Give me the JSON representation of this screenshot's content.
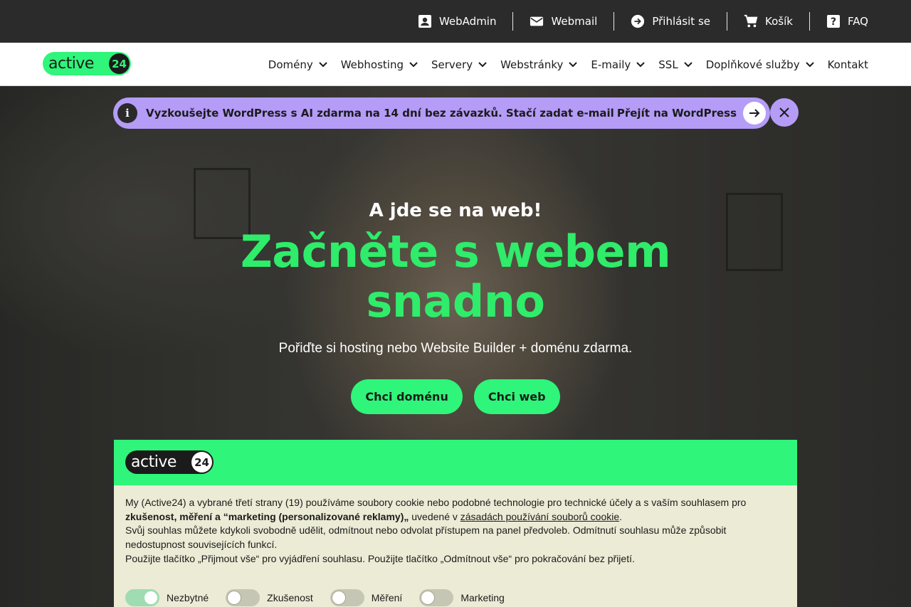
{
  "topbar": {
    "items": [
      {
        "label": "WebAdmin",
        "icon": "account-box-icon"
      },
      {
        "label": "Webmail",
        "icon": "mail-icon"
      },
      {
        "label": "Přihlásit se",
        "icon": "login-arrow-icon"
      },
      {
        "label": "Košík",
        "icon": "cart-icon"
      },
      {
        "label": "FAQ",
        "icon": "help-icon"
      }
    ]
  },
  "brand": {
    "word": "active",
    "number": "24",
    "color": "#2ff57a"
  },
  "menu": {
    "items": [
      "Domény",
      "Webhosting",
      "Servery",
      "Webstránky",
      "E-maily",
      "SSL",
      "Doplňkové služby",
      "Kontakt"
    ]
  },
  "banner": {
    "info_glyph": "i",
    "text": "Vyzkoušejte WordPress s AI zdarma na 14 dní bez závazků. Stačí zadat e-mail",
    "link": "Přejít na WordPress",
    "color": "#b49cf7"
  },
  "hero": {
    "kicker": "A jde se na web!",
    "headline_line1": "Začněte s webem",
    "headline_line2": "snadno",
    "subtitle": "Pořiďte si hosting nebo Website Builder + doménu zdarma.",
    "cta_domain": "Chci doménu",
    "cta_web": "Chci web"
  },
  "cookie": {
    "p1_a": "My (Active24) a vybrané třetí strany (19) používáme soubory cookie nebo podobné technologie pro technické účely a s vaším souhlasem pro ",
    "p1_bold": "zkušenost, měření a “marketing (personalizované reklamy)„",
    "p1_b": " uvedené v ",
    "p1_link": "zásadách používání souborů cookie",
    "p1_c": ".",
    "p2": "Svůj souhlas můžete kdykoli svobodně udělit, odmítnout nebo odvolat přístupem na panel předvoleb. Odmítnutí souhlasu může způsobit nedostupnost souvisejících funkcí.",
    "p3": "Použijte tlačítko „Přijmout vše“ pro vyjádření souhlasu. Použijte tlačítko „Odmítnout vše“ pro pokračování bez přijetí.",
    "toggles": [
      {
        "label": "Nezbytné",
        "on": true
      },
      {
        "label": "Zkušenost",
        "on": false
      },
      {
        "label": "Měření",
        "on": false
      },
      {
        "label": "Marketing",
        "on": false
      }
    ]
  }
}
